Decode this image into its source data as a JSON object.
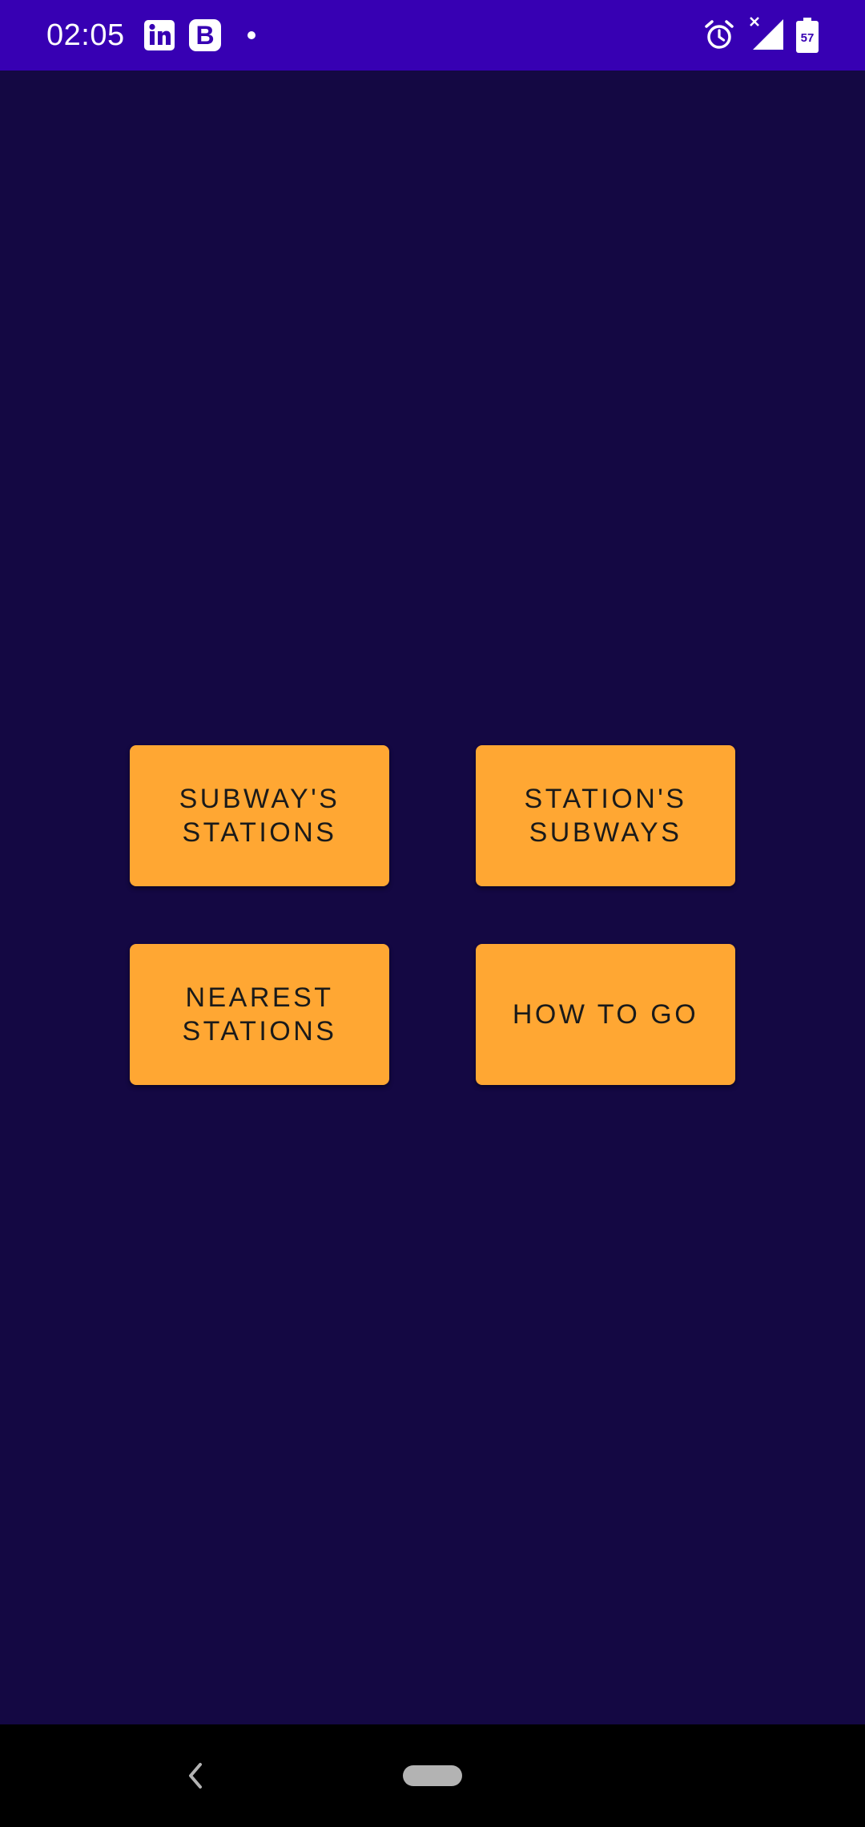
{
  "status_bar": {
    "time": "02:05",
    "background": "#3700b3",
    "notification_icons": [
      "linkedin-icon",
      "b-app-icon",
      "dot-icon"
    ],
    "b_icon_letter": "B",
    "system_icons": [
      "alarm-icon",
      "signal-no-data-icon",
      "battery-icon"
    ],
    "battery_level": "57"
  },
  "main": {
    "background": "#140843",
    "button_color": "#ffa733",
    "buttons": [
      {
        "label": "SUBWAY'S\nSTATIONS"
      },
      {
        "label": "STATION'S\nSUBWAYS"
      },
      {
        "label": "NEAREST\nSTATIONS"
      },
      {
        "label": "HOW TO GO"
      }
    ]
  },
  "nav_bar": {
    "icons": [
      "back-icon",
      "home-pill-icon"
    ]
  }
}
